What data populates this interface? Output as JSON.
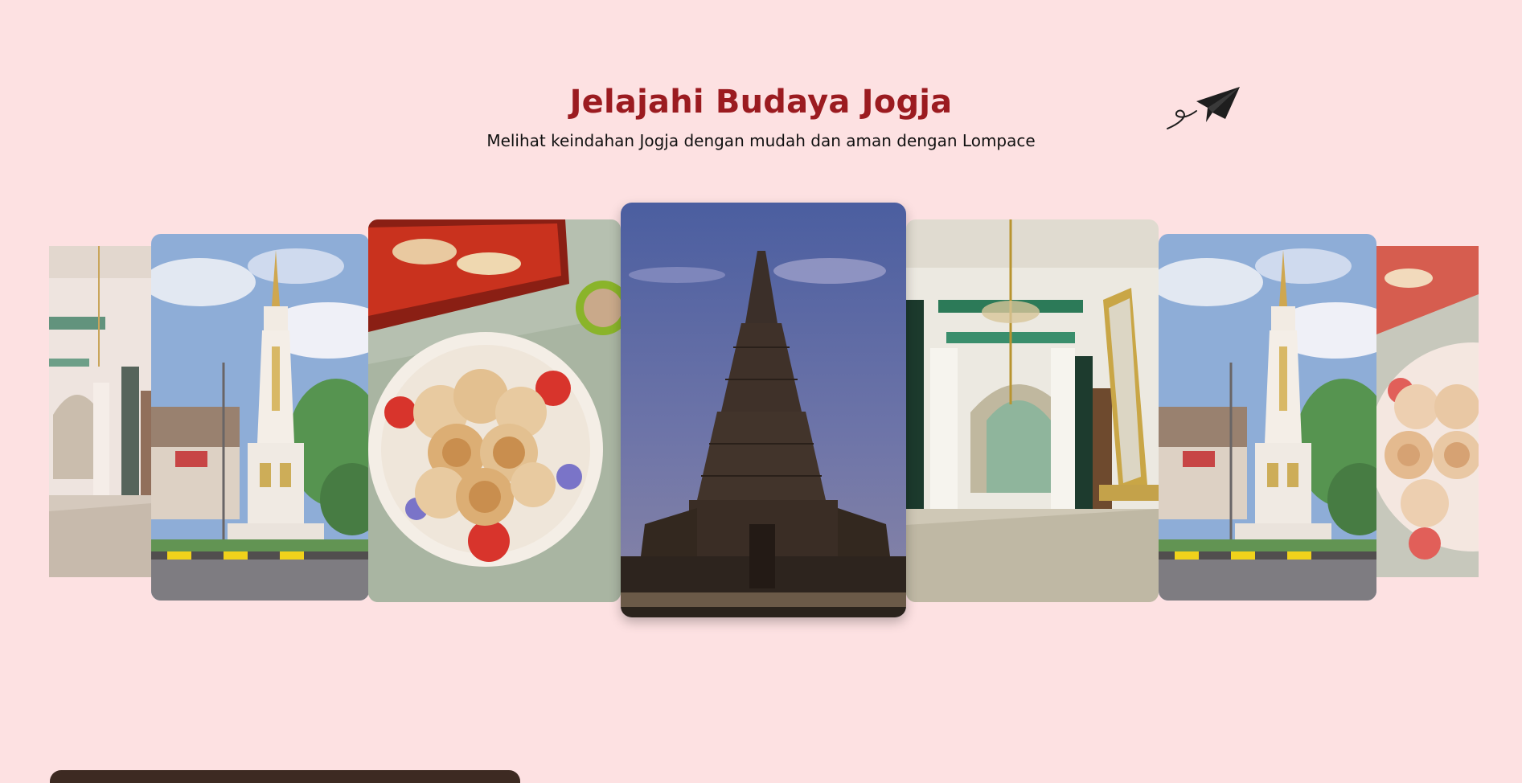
{
  "header": {
    "title": "Jelajahi Budaya Jogja",
    "subtitle": "Melihat keindahan Jogja dengan mudah dan aman dengan Lompace"
  },
  "carousel": {
    "active_index": 3,
    "slides": [
      {
        "subject": "keraton-hallway"
      },
      {
        "subject": "tugu-monument"
      },
      {
        "subject": "bakpia-pastries"
      },
      {
        "subject": "prambanan-temple"
      },
      {
        "subject": "keraton-hallway"
      },
      {
        "subject": "tugu-monument"
      },
      {
        "subject": "bakpia-pastries"
      }
    ]
  },
  "colors": {
    "background": "#fde1e2",
    "title": "#9b1b20",
    "subtitle": "#111111"
  },
  "icons": {
    "decoration": "paper-plane-icon"
  }
}
